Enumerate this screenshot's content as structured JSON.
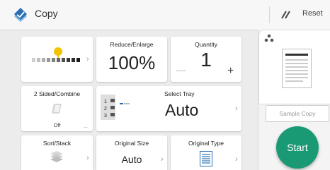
{
  "header": {
    "title": "Copy",
    "reset_label": "Reset"
  },
  "tiles": {
    "density": {
      "level_fraction": 0.5
    },
    "reduce": {
      "label": "Reduce/Enlarge",
      "value": "100%"
    },
    "quantity": {
      "label": "Quantity",
      "value": "1",
      "minus": "—",
      "plus": "+"
    },
    "sided": {
      "label": "2 Sided/Combine",
      "value": "Off",
      "more": "..."
    },
    "tray": {
      "label": "Select Tray",
      "value": "Auto",
      "trays": [
        "1",
        "2",
        "3"
      ]
    },
    "sort": {
      "label": "Sort/Stack"
    },
    "original_size": {
      "label": "Original Size",
      "value": "Auto"
    },
    "original_type": {
      "label": "Original Type"
    }
  },
  "right_panel": {
    "sample_copy_label": "Sample Copy",
    "start_label": "Start"
  },
  "colors": {
    "accent": "#1a9a74",
    "density_marker": "#f2c400",
    "app_icon": "#2b6fb3"
  },
  "chevron": "›"
}
